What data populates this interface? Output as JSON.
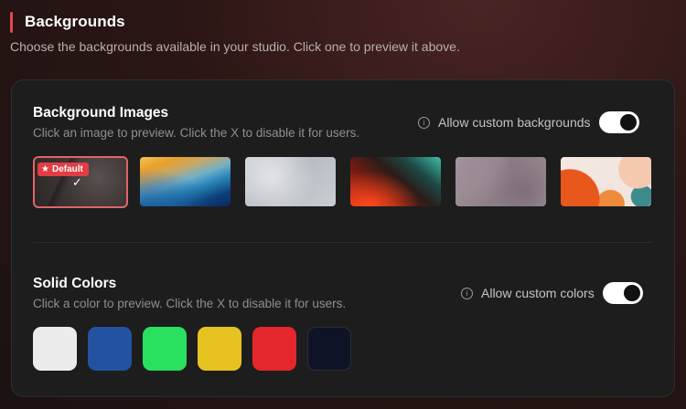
{
  "header": {
    "title": "Backgrounds",
    "subtitle": "Choose the backgrounds available in your studio. Click one to preview it above.",
    "accent_color": "#e8454a"
  },
  "images": {
    "title": "Background Images",
    "description": "Click an image to preview. Click the X to disable it for users.",
    "toggle_label": "Allow custom backgrounds",
    "toggle_on": true,
    "default_badge": "Default",
    "selected_index": 0,
    "thumbnails": [
      {
        "name": "dark-concrete-texture",
        "selected": true,
        "default": true
      },
      {
        "name": "blue-yellow-gradient",
        "selected": false,
        "default": false
      },
      {
        "name": "silver-grain-texture",
        "selected": false,
        "default": false
      },
      {
        "name": "red-teal-grain-gradient",
        "selected": false,
        "default": false
      },
      {
        "name": "mauve-stone-texture",
        "selected": false,
        "default": false
      },
      {
        "name": "orange-abstract-shapes",
        "selected": false,
        "default": false
      }
    ]
  },
  "colors": {
    "title": "Solid Colors",
    "description": "Click a color to preview. Click the X to disable it for users.",
    "toggle_label": "Allow custom colors",
    "toggle_on": true,
    "swatches": [
      "#ececec",
      "#2353a0",
      "#29e05f",
      "#e6c321",
      "#e3272c",
      "#0e1426"
    ]
  }
}
